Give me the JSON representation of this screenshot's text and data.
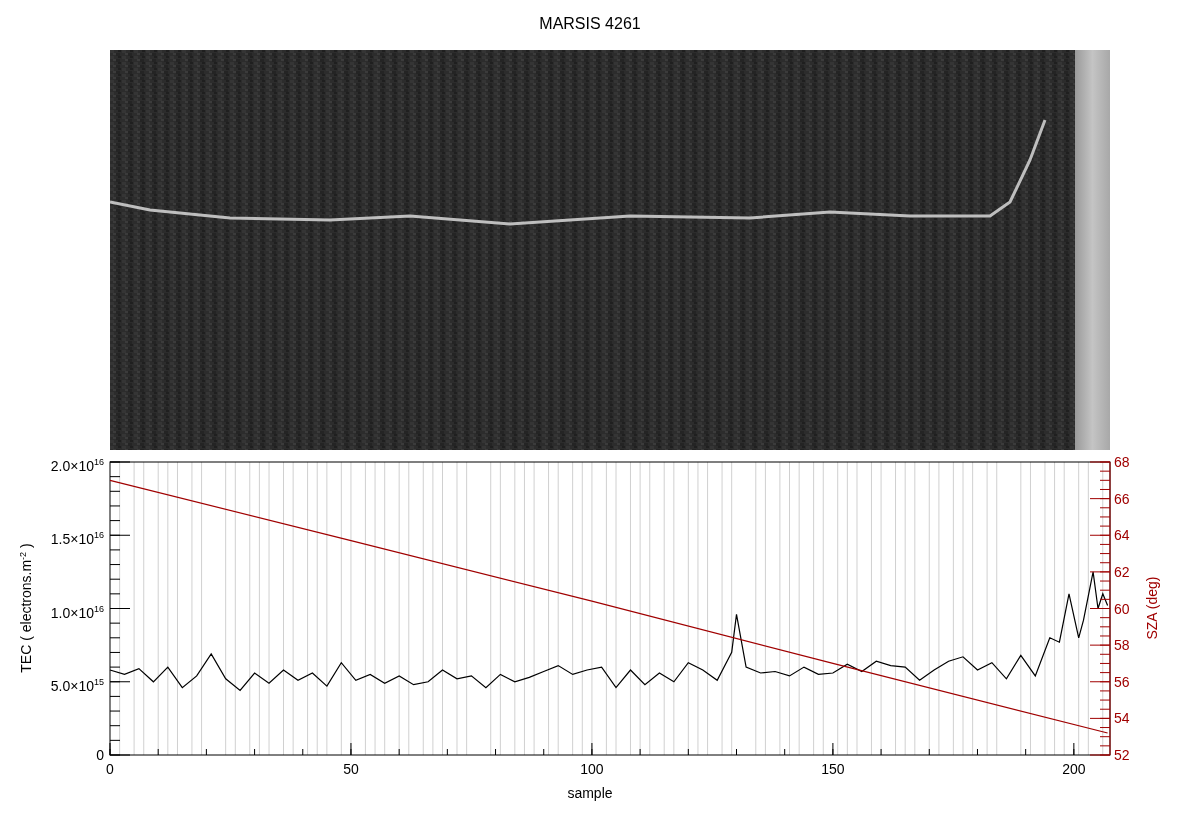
{
  "title": "MARSIS 4261",
  "tec_plot": {
    "chart_data": {
      "type": "line",
      "xlabel": "sample",
      "ylabel": "TEC ( electrons.m$^{-2}$ )",
      "xlim": [
        0,
        207.5
      ],
      "ylim": [
        0,
        2e+16
      ],
      "xticks": [
        0,
        50,
        100,
        150,
        200
      ],
      "yticks": [
        {
          "value": 0,
          "label": "0"
        },
        {
          "value": 5000000000000000.0,
          "label": "5.0×10$^{15}$"
        },
        {
          "value": 1e+16,
          "label": "1.0×10$^{16}$"
        },
        {
          "value": 1.5e+16,
          "label": "1.5×10$^{16}$"
        },
        {
          "value": 2e+16,
          "label": "2.0×10$^{16}$"
        }
      ],
      "x": [
        0,
        3,
        6,
        9,
        12,
        15,
        18,
        21,
        24,
        27,
        30,
        33,
        36,
        39,
        42,
        45,
        48,
        51,
        54,
        57,
        60,
        63,
        66,
        69,
        72,
        75,
        78,
        81,
        84,
        87,
        90,
        93,
        96,
        99,
        102,
        105,
        108,
        111,
        114,
        117,
        120,
        123,
        126,
        129,
        130,
        132,
        135,
        138,
        141,
        144,
        147,
        150,
        153,
        156,
        159,
        162,
        165,
        168,
        171,
        174,
        177,
        180,
        183,
        186,
        189,
        192,
        195,
        197,
        199,
        201,
        202,
        204,
        205,
        206,
        207
      ],
      "series": [
        {
          "color": "#000000",
          "values": [
            5800000000000000.0,
            5500000000000000.0,
            5900000000000000.0,
            5000000000000000.0,
            6000000000000000.0,
            4600000000000000.0,
            5400000000000000.0,
            6900000000000000.0,
            5200000000000000.0,
            4400000000000000.0,
            5600000000000000.0,
            4900000000000000.0,
            5800000000000000.0,
            5100000000000000.0,
            5600000000000000.0,
            4700000000000000.0,
            6300000000000000.0,
            5100000000000000.0,
            5500000000000000.0,
            4900000000000000.0,
            5400000000000000.0,
            4800000000000000.0,
            5000000000000000.0,
            5800000000000000.0,
            5200000000000000.0,
            5400000000000000.0,
            4600000000000000.0,
            5500000000000000.0,
            5000000000000000.0,
            5300000000000000.0,
            5700000000000000.0,
            6100000000000000.0,
            5500000000000000.0,
            5800000000000000.0,
            6000000000000000.0,
            4600000000000000.0,
            5800000000000000.0,
            4800000000000000.0,
            5600000000000000.0,
            5000000000000000.0,
            6300000000000000.0,
            5800000000000000.0,
            5100000000000000.0,
            7000000000000000.0,
            9600000000000000.0,
            6000000000000000.0,
            5600000000000000.0,
            5700000000000000.0,
            5400000000000000.0,
            6000000000000000.0,
            5500000000000000.0,
            5600000000000000.0,
            6200000000000000.0,
            5700000000000000.0,
            6400000000000000.0,
            6100000000000000.0,
            6000000000000000.0,
            5100000000000000.0,
            5800000000000000.0,
            6400000000000000.0,
            6700000000000000.0,
            5800000000000000.0,
            6300000000000000.0,
            5200000000000000.0,
            6800000000000000.0,
            5400000000000000.0,
            8000000000000000.0,
            7700000000000000.0,
            1.1e+16,
            8000000000000000.0,
            9200000000000000.0,
            1.25e+16,
            1e+16,
            1.1e+16,
            1.02e+16
          ]
        }
      ]
    }
  },
  "sza_plot": {
    "chart_data": {
      "type": "line",
      "ylabel": "SZA (deg)",
      "xlim": [
        0,
        207.5
      ],
      "ylim": [
        52,
        68
      ],
      "yticks": [
        52,
        54,
        56,
        58,
        60,
        62,
        64,
        66,
        68
      ],
      "x": [
        0,
        50,
        100,
        150,
        207
      ],
      "series": [
        {
          "color": "#a00000",
          "values": [
            67.0,
            63.7,
            60.4,
            57.0,
            53.2
          ]
        }
      ]
    }
  }
}
